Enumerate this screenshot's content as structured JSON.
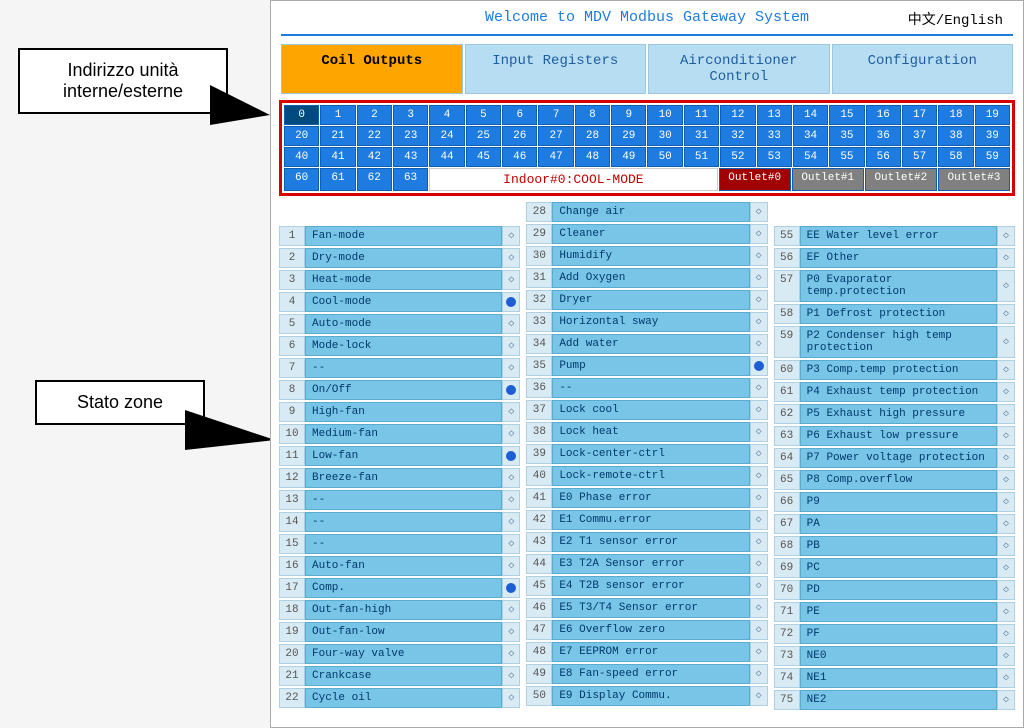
{
  "header": {
    "title": "Welcome to MDV Modbus Gateway System",
    "lang_cn": "中文",
    "lang_en": "English"
  },
  "tabs": [
    {
      "label": "Coil Outputs",
      "active": true
    },
    {
      "label": "Input Registers",
      "active": false
    },
    {
      "label": "Airconditioner Control",
      "active": false
    },
    {
      "label": "Configuration",
      "active": false
    }
  ],
  "addresses": {
    "row0": [
      0,
      1,
      2,
      3,
      4,
      5,
      6,
      7,
      8,
      9,
      10,
      11,
      12,
      13,
      14,
      15,
      16,
      17,
      18,
      19
    ],
    "row1": [
      20,
      21,
      22,
      23,
      24,
      25,
      26,
      27,
      28,
      29,
      30,
      31,
      32,
      33,
      34,
      35,
      36,
      37,
      38,
      39
    ],
    "row2": [
      40,
      41,
      42,
      43,
      44,
      45,
      46,
      47,
      48,
      49,
      50,
      51,
      52,
      53,
      54,
      55,
      56,
      57,
      58,
      59
    ],
    "row3_addrs": [
      60,
      61,
      62,
      63
    ],
    "indoor_label": "Indoor#0:COOL-MODE",
    "outlets": [
      {
        "label": "Outlet#0",
        "active": true
      },
      {
        "label": "Outlet#1",
        "active": false
      },
      {
        "label": "Outlet#2",
        "active": false
      },
      {
        "label": "Outlet#3",
        "active": false
      }
    ]
  },
  "callouts": {
    "c1_line1": "Indirizzo unità",
    "c1_line2": "interne/esterne",
    "c2": "Stato zone"
  },
  "columns": {
    "col1": [
      {
        "n": 1,
        "t": "Fan-mode",
        "on": false
      },
      {
        "n": 2,
        "t": "Dry-mode",
        "on": false
      },
      {
        "n": 3,
        "t": "Heat-mode",
        "on": false
      },
      {
        "n": 4,
        "t": "Cool-mode",
        "on": true
      },
      {
        "n": 5,
        "t": "Auto-mode",
        "on": false
      },
      {
        "n": 6,
        "t": "Mode-lock",
        "on": false
      },
      {
        "n": 7,
        "t": "--",
        "on": false
      },
      {
        "n": 8,
        "t": "On/Off",
        "on": true
      },
      {
        "n": 9,
        "t": "High-fan",
        "on": false
      },
      {
        "n": 10,
        "t": "Medium-fan",
        "on": false
      },
      {
        "n": 11,
        "t": "Low-fan",
        "on": true
      },
      {
        "n": 12,
        "t": "Breeze-fan",
        "on": false
      },
      {
        "n": 13,
        "t": "--",
        "on": false
      },
      {
        "n": 14,
        "t": "--",
        "on": false
      },
      {
        "n": 15,
        "t": "--",
        "on": false
      },
      {
        "n": 16,
        "t": "Auto-fan",
        "on": false
      },
      {
        "n": 17,
        "t": "Comp.",
        "on": true
      },
      {
        "n": 18,
        "t": "Out-fan-high",
        "on": false
      },
      {
        "n": 19,
        "t": "Out-fan-low",
        "on": false
      },
      {
        "n": 20,
        "t": "Four-way valve",
        "on": false
      },
      {
        "n": 21,
        "t": "Crankcase",
        "on": false
      },
      {
        "n": 22,
        "t": "Cycle oil",
        "on": false
      }
    ],
    "col2": [
      {
        "n": 28,
        "t": "Change air",
        "on": false
      },
      {
        "n": 29,
        "t": "Cleaner",
        "on": false
      },
      {
        "n": 30,
        "t": "Humidify",
        "on": false
      },
      {
        "n": 31,
        "t": "Add Oxygen",
        "on": false
      },
      {
        "n": 32,
        "t": "Dryer",
        "on": false
      },
      {
        "n": 33,
        "t": "Horizontal sway",
        "on": false
      },
      {
        "n": 34,
        "t": "Add water",
        "on": false
      },
      {
        "n": 35,
        "t": "Pump",
        "on": true
      },
      {
        "n": 36,
        "t": "--",
        "on": false
      },
      {
        "n": 37,
        "t": "Lock cool",
        "on": false
      },
      {
        "n": 38,
        "t": "Lock heat",
        "on": false
      },
      {
        "n": 39,
        "t": "Lock-center-ctrl",
        "on": false
      },
      {
        "n": 40,
        "t": "Lock-remote-ctrl",
        "on": false
      },
      {
        "n": 41,
        "t": "E0 Phase error",
        "on": false
      },
      {
        "n": 42,
        "t": "E1 Commu.error",
        "on": false
      },
      {
        "n": 43,
        "t": "E2 T1 sensor error",
        "on": false
      },
      {
        "n": 44,
        "t": "E3 T2A Sensor error",
        "on": false
      },
      {
        "n": 45,
        "t": "E4 T2B sensor error",
        "on": false
      },
      {
        "n": 46,
        "t": "E5 T3/T4 Sensor error",
        "on": false
      },
      {
        "n": 47,
        "t": "E6 Overflow zero",
        "on": false
      },
      {
        "n": 48,
        "t": "E7 EEPROM error",
        "on": false
      },
      {
        "n": 49,
        "t": "E8 Fan-speed error",
        "on": false
      },
      {
        "n": 50,
        "t": "E9 Display Commu.",
        "on": false
      }
    ],
    "col3": [
      {
        "n": 55,
        "t": "EE Water level error",
        "on": false
      },
      {
        "n": 56,
        "t": "EF Other",
        "on": false
      },
      {
        "n": 57,
        "t": "P0 Evaporator temp.protection",
        "on": false
      },
      {
        "n": 58,
        "t": "P1 Defrost protection",
        "on": false
      },
      {
        "n": 59,
        "t": "P2 Condenser high temp protection",
        "on": false
      },
      {
        "n": 60,
        "t": "P3 Comp.temp protection",
        "on": false
      },
      {
        "n": 61,
        "t": "P4 Exhaust temp protection",
        "on": false
      },
      {
        "n": 62,
        "t": "P5 Exhaust high pressure",
        "on": false
      },
      {
        "n": 63,
        "t": "P6 Exhaust low pressure",
        "on": false
      },
      {
        "n": 64,
        "t": "P7 Power voltage protection",
        "on": false
      },
      {
        "n": 65,
        "t": "P8 Comp.overflow",
        "on": false
      },
      {
        "n": 66,
        "t": "P9",
        "on": false
      },
      {
        "n": 67,
        "t": "PA",
        "on": false
      },
      {
        "n": 68,
        "t": "PB",
        "on": false
      },
      {
        "n": 69,
        "t": "PC",
        "on": false
      },
      {
        "n": 70,
        "t": "PD",
        "on": false
      },
      {
        "n": 71,
        "t": "PE",
        "on": false
      },
      {
        "n": 72,
        "t": "PF",
        "on": false
      },
      {
        "n": 73,
        "t": "NE0",
        "on": false
      },
      {
        "n": 74,
        "t": "NE1",
        "on": false
      },
      {
        "n": 75,
        "t": "NE2",
        "on": false
      }
    ]
  }
}
